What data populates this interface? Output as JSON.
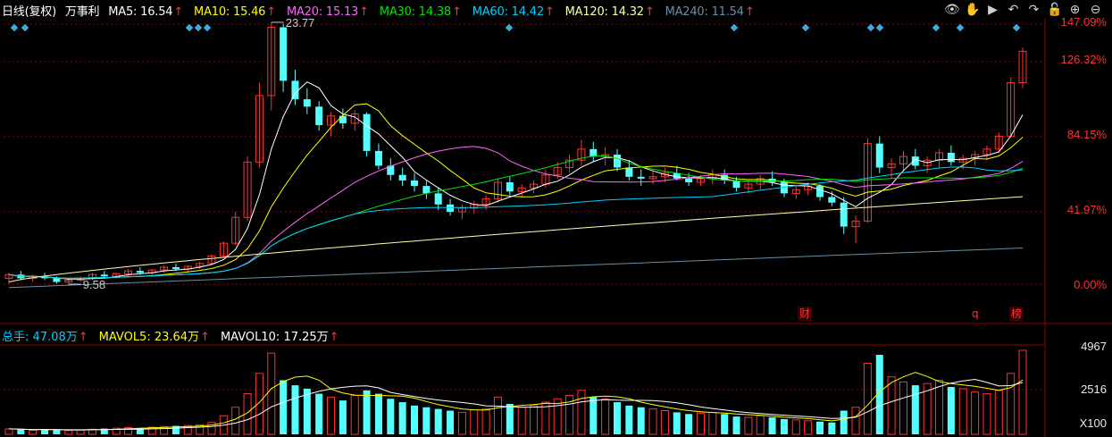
{
  "header": {
    "period": "日线(复权)",
    "stock_name": "万事利",
    "ma": [
      {
        "label": "MA5: ",
        "value": "16.54",
        "color": "#ffffff"
      },
      {
        "label": "MA10: ",
        "value": "15.46",
        "color": "#ffff00"
      },
      {
        "label": "MA20: ",
        "value": "15.13",
        "color": "#ff66ff"
      },
      {
        "label": "MA30: ",
        "value": "14.38",
        "color": "#00e600"
      },
      {
        "label": "MA60: ",
        "value": "14.42",
        "color": "#00d0ff"
      },
      {
        "label": "MA120: ",
        "value": "14.32",
        "color": "#ffffaa"
      },
      {
        "label": "MA240: ",
        "value": "11.54",
        "color": "#6b8fa3"
      }
    ],
    "arrow": "↑"
  },
  "toolbar": {
    "icons": [
      "eye-icon",
      "hand-icon",
      "play-icon",
      "undo-icon",
      "redo-icon",
      "lock-icon",
      "zoom-in-icon",
      "zoom-out-icon"
    ],
    "glyphs": [
      "👁",
      "✋",
      "▶",
      "↶",
      "↷",
      "🔓",
      "⊕",
      "⊖"
    ]
  },
  "price_axis": {
    "labels": [
      "147.09%",
      "126.32%",
      "84.15%",
      "41.97%",
      "0.00%"
    ]
  },
  "volume_axis": {
    "labels": [
      "4967",
      "2516",
      "X100"
    ]
  },
  "annotations": {
    "high": "23.77",
    "low": "9.58",
    "markers": [
      "财",
      "q",
      "榜"
    ]
  },
  "volume_header": {
    "items": [
      {
        "label": "总手: ",
        "value": "47.08万",
        "color": "#00d0ff"
      },
      {
        "label": "MAVOL5: ",
        "value": "23.64万",
        "color": "#ffff00"
      },
      {
        "label": "MAVOL10: ",
        "value": "17.25万",
        "color": "#ffffff"
      }
    ],
    "arrow": "↑"
  },
  "colors": {
    "up": "#ff3232",
    "down": "#54ffff",
    "grid": "#8b0000",
    "background": "#000000"
  },
  "chart_data": {
    "type": "candlestick",
    "ylim_percent": [
      0,
      147.09
    ],
    "price_base": 9.58,
    "high_price": 23.77,
    "ohlc": [
      [
        9.9,
        10.2,
        9.6,
        10.1
      ],
      [
        10.1,
        10.3,
        9.8,
        9.9
      ],
      [
        9.9,
        10.1,
        9.7,
        10.0
      ],
      [
        10.0,
        10.2,
        9.8,
        9.9
      ],
      [
        9.9,
        10.0,
        9.6,
        9.7
      ],
      [
        9.7,
        9.9,
        9.58,
        9.8
      ],
      [
        9.8,
        10.0,
        9.7,
        9.9
      ],
      [
        9.9,
        10.2,
        9.8,
        10.1
      ],
      [
        10.1,
        10.3,
        9.9,
        10.0
      ],
      [
        10.0,
        10.2,
        9.9,
        10.15
      ],
      [
        10.15,
        10.4,
        10.0,
        10.3
      ],
      [
        10.3,
        10.5,
        10.1,
        10.2
      ],
      [
        10.2,
        10.4,
        10.0,
        10.35
      ],
      [
        10.35,
        10.6,
        10.2,
        10.5
      ],
      [
        10.5,
        10.7,
        10.3,
        10.4
      ],
      [
        10.4,
        10.6,
        10.2,
        10.55
      ],
      [
        10.55,
        10.8,
        10.4,
        10.7
      ],
      [
        10.7,
        11.2,
        10.6,
        11.1
      ],
      [
        11.1,
        11.9,
        11.0,
        11.8
      ],
      [
        11.8,
        13.5,
        11.7,
        13.2
      ],
      [
        13.2,
        16.5,
        13.0,
        16.2
      ],
      [
        16.2,
        20.5,
        15.9,
        19.8
      ],
      [
        19.8,
        23.77,
        19.0,
        23.5
      ],
      [
        23.5,
        23.7,
        20.0,
        20.6
      ],
      [
        20.6,
        21.2,
        19.3,
        19.6
      ],
      [
        19.6,
        20.2,
        18.8,
        19.2
      ],
      [
        19.2,
        19.5,
        17.9,
        18.2
      ],
      [
        18.2,
        18.9,
        17.6,
        18.7
      ],
      [
        18.7,
        19.1,
        18.0,
        18.3
      ],
      [
        18.3,
        19.0,
        17.9,
        18.8
      ],
      [
        18.8,
        18.9,
        16.5,
        16.8
      ],
      [
        16.8,
        17.2,
        15.8,
        16.0
      ],
      [
        16.0,
        16.4,
        15.2,
        15.5
      ],
      [
        15.5,
        15.9,
        14.9,
        15.2
      ],
      [
        15.2,
        15.6,
        14.6,
        14.9
      ],
      [
        14.9,
        15.2,
        14.2,
        14.5
      ],
      [
        14.5,
        14.8,
        13.6,
        13.9
      ],
      [
        13.9,
        14.2,
        13.3,
        13.5
      ],
      [
        13.5,
        13.9,
        13.1,
        13.7
      ],
      [
        13.7,
        14.1,
        13.4,
        13.9
      ],
      [
        13.9,
        14.4,
        13.6,
        14.2
      ],
      [
        14.2,
        15.3,
        14.0,
        15.1
      ],
      [
        15.1,
        15.4,
        14.4,
        14.6
      ],
      [
        14.6,
        15.0,
        14.3,
        14.8
      ],
      [
        14.8,
        15.2,
        14.5,
        15.0
      ],
      [
        15.0,
        15.8,
        14.8,
        15.5
      ],
      [
        15.5,
        16.2,
        15.3,
        15.9
      ],
      [
        15.9,
        16.6,
        15.6,
        16.3
      ],
      [
        16.3,
        17.4,
        16.0,
        16.9
      ],
      [
        16.9,
        17.3,
        16.2,
        16.5
      ],
      [
        16.5,
        17.0,
        16.0,
        16.6
      ],
      [
        16.6,
        16.9,
        15.7,
        15.9
      ],
      [
        15.9,
        16.3,
        15.2,
        15.4
      ],
      [
        15.4,
        15.8,
        14.9,
        15.3
      ],
      [
        15.3,
        15.7,
        15.0,
        15.4
      ],
      [
        15.4,
        15.9,
        15.1,
        15.6
      ],
      [
        15.6,
        16.0,
        15.2,
        15.3
      ],
      [
        15.3,
        15.6,
        14.9,
        15.1
      ],
      [
        15.1,
        15.5,
        14.9,
        15.3
      ],
      [
        15.3,
        15.8,
        15.0,
        15.5
      ],
      [
        15.5,
        15.8,
        15.0,
        15.2
      ],
      [
        15.2,
        15.4,
        14.6,
        14.8
      ],
      [
        14.8,
        15.2,
        14.5,
        15.0
      ],
      [
        15.0,
        15.5,
        14.7,
        15.3
      ],
      [
        15.3,
        15.7,
        14.9,
        15.1
      ],
      [
        15.1,
        15.3,
        14.3,
        14.5
      ],
      [
        14.5,
        14.9,
        14.2,
        14.7
      ],
      [
        14.7,
        15.1,
        14.4,
        14.9
      ],
      [
        14.9,
        15.0,
        14.1,
        14.3
      ],
      [
        14.3,
        14.6,
        13.8,
        14.0
      ],
      [
        14.0,
        14.3,
        12.3,
        12.7
      ],
      [
        12.7,
        13.3,
        11.8,
        13.0
      ],
      [
        13.0,
        17.5,
        12.9,
        17.2
      ],
      [
        17.2,
        17.6,
        15.6,
        15.9
      ],
      [
        15.9,
        16.4,
        15.3,
        16.1
      ],
      [
        16.1,
        16.8,
        15.7,
        16.5
      ],
      [
        16.5,
        16.9,
        15.8,
        16.0
      ],
      [
        16.0,
        16.5,
        15.6,
        16.3
      ],
      [
        16.3,
        16.9,
        15.9,
        16.7
      ],
      [
        16.7,
        17.1,
        16.0,
        16.2
      ],
      [
        16.2,
        16.6,
        15.8,
        16.4
      ],
      [
        16.4,
        16.8,
        16.0,
        16.6
      ],
      [
        16.6,
        17.1,
        16.3,
        16.9
      ],
      [
        16.9,
        17.8,
        16.7,
        17.6
      ],
      [
        17.6,
        20.8,
        17.5,
        20.5
      ],
      [
        20.5,
        22.4,
        20.2,
        22.2
      ]
    ],
    "ma_values": {
      "MA5": 16.54,
      "MA10": 15.46,
      "MA20": 15.13,
      "MA30": 14.38,
      "MA60": 14.42,
      "MA120": 14.32,
      "MA240": 11.54
    },
    "volume_unit": "X100",
    "volume_ylim": [
      0,
      4967
    ],
    "volume": [
      320,
      280,
      240,
      300,
      260,
      220,
      260,
      300,
      340,
      360,
      400,
      380,
      420,
      460,
      500,
      520,
      560,
      700,
      1100,
      1600,
      2400,
      3600,
      4800,
      3200,
      2900,
      2700,
      2400,
      2200,
      2000,
      2300,
      2600,
      2400,
      2100,
      1900,
      1700,
      1600,
      1500,
      1400,
      1300,
      1450,
      1500,
      2200,
      1800,
      1600,
      1700,
      1900,
      2100,
      2300,
      2600,
      2200,
      2100,
      1900,
      1700,
      1600,
      1500,
      1400,
      1300,
      1200,
      1250,
      1300,
      1200,
      1050,
      1000,
      1100,
      1000,
      900,
      850,
      800,
      750,
      700,
      1400,
      1600,
      4200,
      4700,
      3400,
      3100,
      2900,
      3000,
      3200,
      2800,
      2700,
      2500,
      2400,
      2600,
      3600,
      4967
    ]
  }
}
